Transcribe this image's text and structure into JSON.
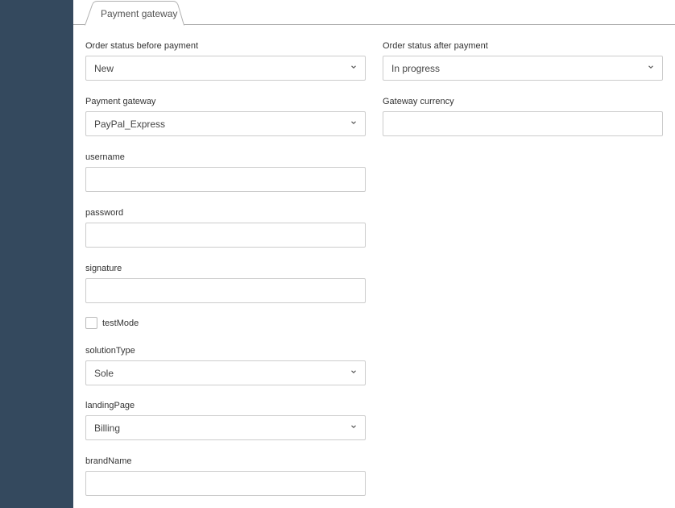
{
  "tabs": [
    {
      "label": "Payment gateway",
      "active": true
    }
  ],
  "form": {
    "order_status_before": {
      "label": "Order status before payment",
      "value": "New"
    },
    "order_status_after": {
      "label": "Order status after payment",
      "value": "In progress"
    },
    "payment_gateway": {
      "label": "Payment gateway",
      "value": "PayPal_Express"
    },
    "gateway_currency": {
      "label": "Gateway currency",
      "value": ""
    },
    "username": {
      "label": "username",
      "value": ""
    },
    "password": {
      "label": "password",
      "value": ""
    },
    "signature": {
      "label": "signature",
      "value": ""
    },
    "test_mode": {
      "label": "testMode",
      "checked": false
    },
    "solution_type": {
      "label": "solutionType",
      "value": "Sole"
    },
    "landing_page": {
      "label": "landingPage",
      "value": "Billing"
    },
    "brand_name": {
      "label": "brandName",
      "value": ""
    }
  },
  "icons": {
    "select_chevron": "chevron-down-icon"
  },
  "colors": {
    "sidebar": "#34495e",
    "border": "#cccccc",
    "text": "#333333"
  }
}
